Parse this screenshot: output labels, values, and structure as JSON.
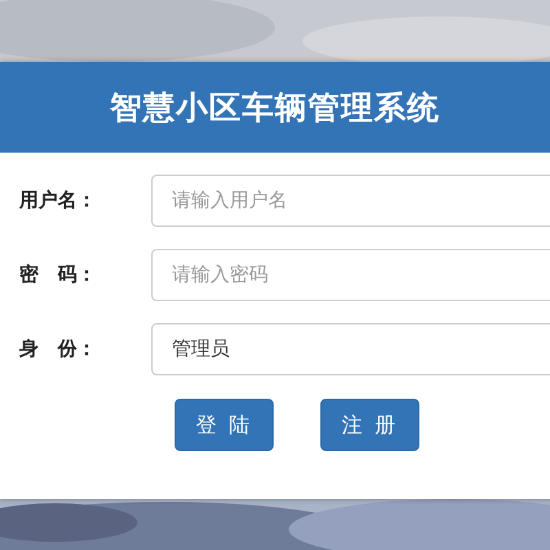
{
  "header": {
    "title": "智慧小区车辆管理系统"
  },
  "fields": [
    {
      "label": "用户名：",
      "placeholder": "请输入用户名"
    },
    {
      "label": "密　码：",
      "placeholder": "请输入密码"
    },
    {
      "label": "身　份：",
      "value": "管理员"
    }
  ],
  "buttons": [
    "登 陆",
    "注 册"
  ]
}
